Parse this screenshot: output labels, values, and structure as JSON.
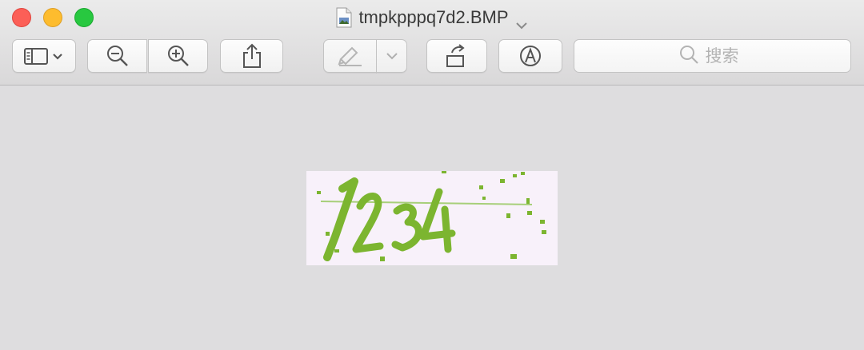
{
  "window": {
    "title": "tmpkpppq7d2.BMP",
    "traffic_lights": {
      "close": "#fc5f57",
      "minimize": "#fdbc2e",
      "maximize": "#28c840"
    }
  },
  "toolbar": {
    "buttons": [
      {
        "name": "sidebar-view-button",
        "icon": "sidebar-icon"
      },
      {
        "name": "zoom-out-button",
        "icon": "zoom-out-icon"
      },
      {
        "name": "zoom-in-button",
        "icon": "zoom-in-icon"
      },
      {
        "name": "share-button",
        "icon": "share-icon"
      },
      {
        "name": "markup-pen-button",
        "icon": "pen-icon"
      },
      {
        "name": "markup-menu-button",
        "icon": "chevron-down-icon"
      },
      {
        "name": "rotate-button",
        "icon": "rotate-icon"
      },
      {
        "name": "annotate-button",
        "icon": "markup-icon"
      }
    ],
    "search": {
      "placeholder": "搜索",
      "icon": "search-icon"
    }
  },
  "document": {
    "image_text": "1234",
    "image_color": "#7cb530",
    "image_background": "#f8f1fa"
  }
}
